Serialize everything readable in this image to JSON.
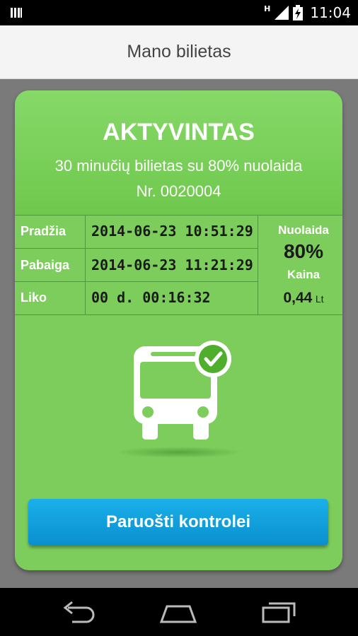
{
  "status_bar": {
    "time": "11:04",
    "network_type": "H"
  },
  "app_bar": {
    "title": "Mano bilietas"
  },
  "ticket": {
    "status": "AKTYVINTAS",
    "description": "30 minučių bilietas su 80% nuolaida",
    "number": "Nr. 0020004",
    "rows": [
      {
        "label": "Pradžia",
        "value": "2014-06-23 10:51:29"
      },
      {
        "label": "Pabaiga",
        "value": "2014-06-23 11:21:29"
      },
      {
        "label": "Liko",
        "value": "00 d. 00:16:32"
      }
    ],
    "discount_label": "Nuolaida",
    "discount_value": "80%",
    "price_label": "Kaina",
    "price_value": "0,44",
    "price_currency": "Lt"
  },
  "action_button": {
    "label": "Paruošti kontrolei"
  },
  "colors": {
    "card": "#7dcd5c",
    "button": "#12a2e0",
    "check": "#4fae2c"
  },
  "icons": [
    "battery-icon",
    "signal-icon",
    "bus-check-icon",
    "back-icon",
    "home-icon",
    "recent-apps-icon"
  ]
}
